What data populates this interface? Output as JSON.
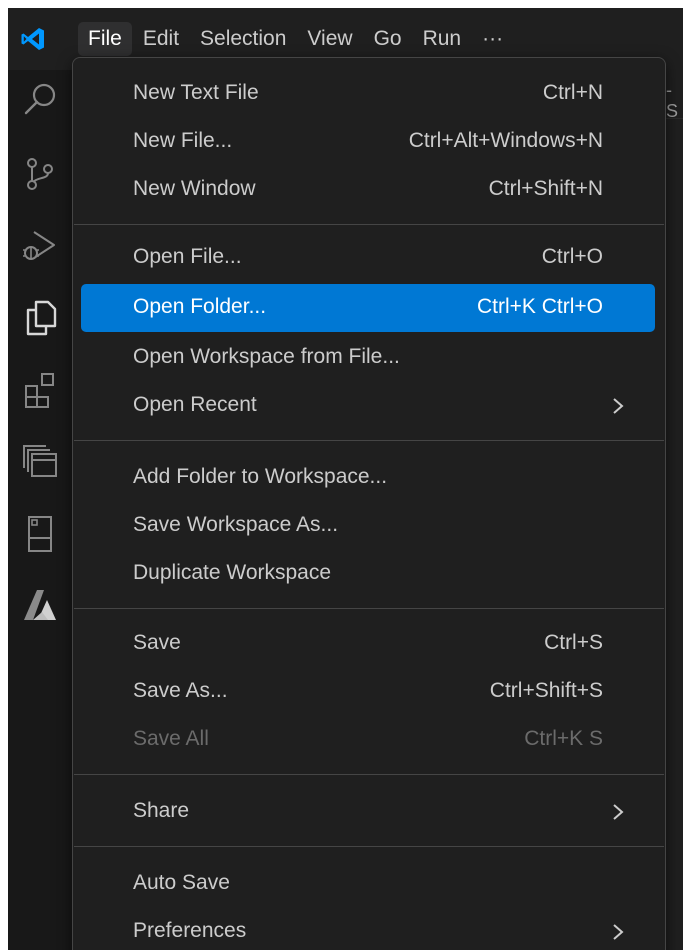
{
  "menubar": {
    "items": [
      "File",
      "Edit",
      "Selection",
      "View",
      "Go",
      "Run",
      "···"
    ],
    "active": "File"
  },
  "tab_partial_text": "- S",
  "file_menu": {
    "groups": [
      [
        {
          "label": "New Text File",
          "shortcut": "Ctrl+N"
        },
        {
          "label": "New File...",
          "shortcut": "Ctrl+Alt+Windows+N"
        },
        {
          "label": "New Window",
          "shortcut": "Ctrl+Shift+N"
        }
      ],
      [
        {
          "label": "Open File...",
          "shortcut": "Ctrl+O"
        },
        {
          "label": "Open Folder...",
          "shortcut": "Ctrl+K Ctrl+O",
          "highlighted": true
        },
        {
          "label": "Open Workspace from File...",
          "shortcut": ""
        },
        {
          "label": "Open Recent",
          "shortcut": "",
          "submenu": true
        }
      ],
      [
        {
          "label": "Add Folder to Workspace...",
          "shortcut": ""
        },
        {
          "label": "Save Workspace As...",
          "shortcut": ""
        },
        {
          "label": "Duplicate Workspace",
          "shortcut": ""
        }
      ],
      [
        {
          "label": "Save",
          "shortcut": "Ctrl+S"
        },
        {
          "label": "Save As...",
          "shortcut": "Ctrl+Shift+S"
        },
        {
          "label": "Save All",
          "shortcut": "Ctrl+K S",
          "disabled": true
        }
      ],
      [
        {
          "label": "Share",
          "shortcut": "",
          "submenu": true
        }
      ],
      [
        {
          "label": "Auto Save",
          "shortcut": ""
        },
        {
          "label": "Preferences",
          "shortcut": "",
          "submenu": true
        }
      ]
    ]
  },
  "activity_icons": [
    "search-icon",
    "source-control-icon",
    "run-debug-icon",
    "explorer-icon",
    "extensions-icon",
    "remote-explorer-icon",
    "testing-icon",
    "azure-icon"
  ],
  "colors": {
    "menu_bg": "#1f1f1f",
    "highlight": "#0078d4",
    "text": "#cccccc",
    "disabled_text": "#6b6b6b",
    "vscode_blue": "#0098ff"
  }
}
